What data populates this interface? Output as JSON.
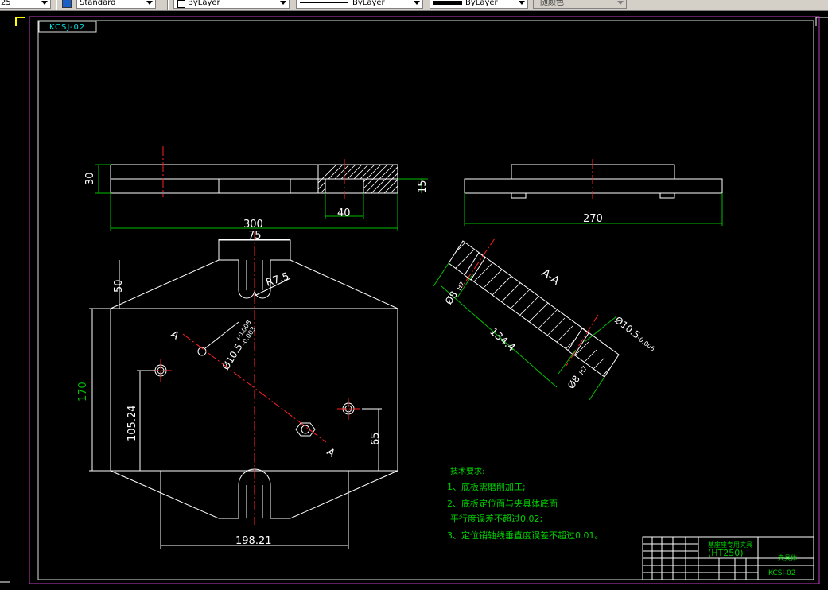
{
  "toolbar": {
    "textstyle_partial": "25",
    "textstyle": "Standard",
    "layer": "ByLayer",
    "linetype": "ByLayer",
    "lineweight": "ByLayer",
    "color": "随颜色"
  },
  "drawing": {
    "code_tag": "KCSJ-02",
    "dimensions": {
      "d30": "30",
      "d15": "15",
      "d40": "40",
      "d300": "300",
      "d270": "270",
      "d75": "75",
      "d50": "50",
      "r75": "R7.5",
      "d170": "170",
      "d10524": "105.24",
      "d65": "65",
      "d19821": "198.21",
      "hole_main": "Ø10.5",
      "hole_main_tol_upper": "+0.008",
      "hole_main_tol_lower": "-0.003",
      "section_hole_a": "Ø8",
      "section_hole_a_tol": "H7",
      "section_hole_b": "Ø8",
      "section_hole_b_tol": "H7",
      "section_hole_c": "Ø10.5",
      "section_hole_c_tol": "-0.006",
      "d1344": "134.4"
    },
    "section_label": "A-A",
    "cut_label_a1": "A",
    "cut_label_a2": "A",
    "tech_req": {
      "title": "技术要求:",
      "line1": "1、底板需磨削加工;",
      "line2": "2、底板定位面与夹具体底面",
      "line3": "平行度误差不超过0.02;",
      "line4": "3、定位销轴线垂直度误差不超过0.01。"
    },
    "title_block": {
      "project": "基座座专用夹具",
      "material": "(HT250)",
      "part_name": "夹具体",
      "code": "KCSJ-02"
    }
  }
}
